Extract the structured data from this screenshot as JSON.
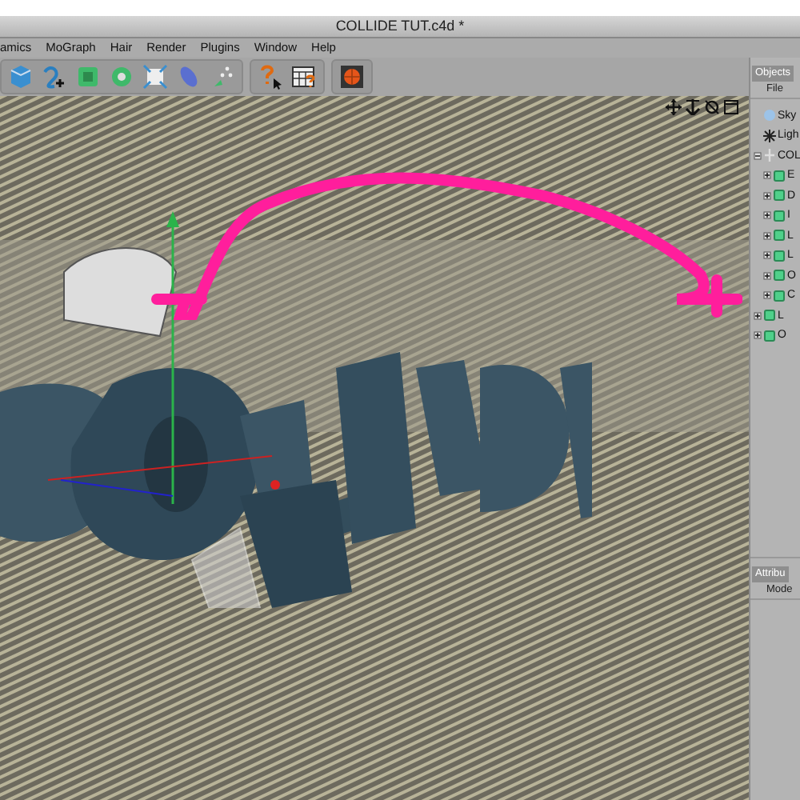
{
  "window": {
    "title": "COLLIDE TUT.c4d *"
  },
  "menu": [
    "amics",
    "MoGraph",
    "Hair",
    "Render",
    "Plugins",
    "Window",
    "Help"
  ],
  "objects_panel": {
    "tab": "Objects",
    "menu": "File",
    "tree": [
      {
        "label": "Sky",
        "kind": "sky"
      },
      {
        "label": "Ligh",
        "kind": "light"
      },
      {
        "label": "COL",
        "kind": "null",
        "toggle": true,
        "expanded": true,
        "children": [
          {
            "label": "E",
            "kind": "object",
            "toggle": true,
            "expanded": false
          },
          {
            "label": "D",
            "kind": "object",
            "toggle": true,
            "expanded": false
          },
          {
            "label": "I",
            "kind": "object",
            "toggle": true,
            "expanded": false
          },
          {
            "label": "L",
            "kind": "object",
            "toggle": true,
            "expanded": false
          },
          {
            "label": "L",
            "kind": "object",
            "toggle": true,
            "expanded": false
          },
          {
            "label": "O",
            "kind": "object",
            "toggle": true,
            "expanded": false
          },
          {
            "label": "C",
            "kind": "object",
            "toggle": true,
            "expanded": false
          }
        ]
      },
      {
        "label": "L",
        "kind": "object",
        "toggle": true,
        "expanded": false
      },
      {
        "label": "O",
        "kind": "object",
        "toggle": true,
        "expanded": false
      }
    ]
  },
  "attributes_panel": {
    "tab": "Attribu",
    "menu": "Mode"
  }
}
